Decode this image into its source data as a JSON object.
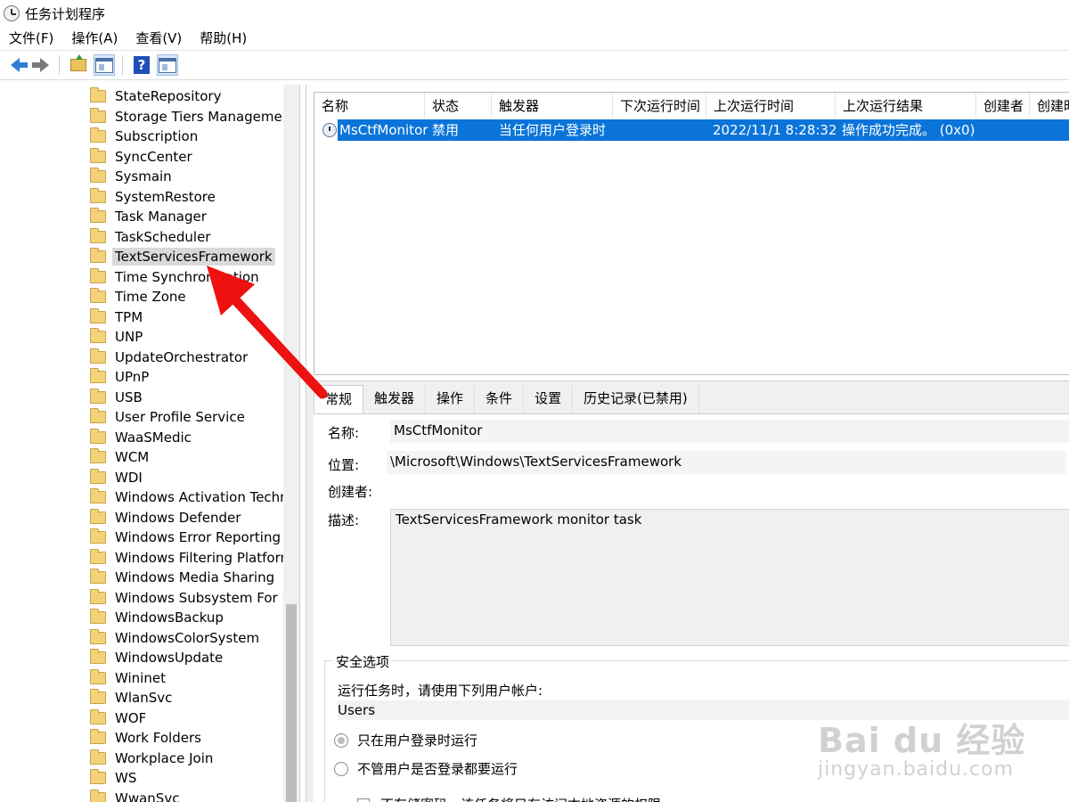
{
  "window": {
    "title": "任务计划程序"
  },
  "menu": {
    "items": [
      "文件(F)",
      "操作(A)",
      "查看(V)",
      "帮助(H)"
    ]
  },
  "toolbar": {
    "help_glyph": "?"
  },
  "tree": {
    "items": [
      {
        "label": "StateRepository",
        "selected": false
      },
      {
        "label": "Storage Tiers Management",
        "selected": false
      },
      {
        "label": "Subscription",
        "selected": false
      },
      {
        "label": "SyncCenter",
        "selected": false
      },
      {
        "label": "Sysmain",
        "selected": false
      },
      {
        "label": "SystemRestore",
        "selected": false
      },
      {
        "label": "Task Manager",
        "selected": false
      },
      {
        "label": "TaskScheduler",
        "selected": false
      },
      {
        "label": "TextServicesFramework",
        "selected": true
      },
      {
        "label": "Time Synchronization",
        "selected": false
      },
      {
        "label": "Time Zone",
        "selected": false
      },
      {
        "label": "TPM",
        "selected": false
      },
      {
        "label": "UNP",
        "selected": false
      },
      {
        "label": "UpdateOrchestrator",
        "selected": false
      },
      {
        "label": "UPnP",
        "selected": false
      },
      {
        "label": "USB",
        "selected": false
      },
      {
        "label": "User Profile Service",
        "selected": false
      },
      {
        "label": "WaaSMedic",
        "selected": false
      },
      {
        "label": "WCM",
        "selected": false
      },
      {
        "label": "WDI",
        "selected": false
      },
      {
        "label": "Windows Activation Technologies",
        "selected": false
      },
      {
        "label": "Windows Defender",
        "selected": false
      },
      {
        "label": "Windows Error Reporting",
        "selected": false
      },
      {
        "label": "Windows Filtering Platform",
        "selected": false
      },
      {
        "label": "Windows Media Sharing",
        "selected": false
      },
      {
        "label": "Windows Subsystem For Linux",
        "selected": false
      },
      {
        "label": "WindowsBackup",
        "selected": false
      },
      {
        "label": "WindowsColorSystem",
        "selected": false
      },
      {
        "label": "WindowsUpdate",
        "selected": false
      },
      {
        "label": "Wininet",
        "selected": false
      },
      {
        "label": "WlanSvc",
        "selected": false
      },
      {
        "label": "WOF",
        "selected": false
      },
      {
        "label": "Work Folders",
        "selected": false
      },
      {
        "label": "Workplace Join",
        "selected": false
      },
      {
        "label": "WS",
        "selected": false
      },
      {
        "label": "WwanSvc",
        "selected": false
      }
    ]
  },
  "task_table": {
    "columns": [
      "名称",
      "状态",
      "触发器",
      "下次运行时间",
      "上次运行时间",
      "上次运行结果",
      "创建者",
      "创建时"
    ],
    "rows": [
      {
        "name": "MsCtfMonitor",
        "status": "禁用",
        "trigger": "当任何用户登录时",
        "next_run": "",
        "last_run": "2022/11/1 8:28:32",
        "last_result": "操作成功完成。 (0x0)",
        "author": ""
      }
    ]
  },
  "detail": {
    "tabs": [
      "常规",
      "触发器",
      "操作",
      "条件",
      "设置",
      "历史记录(已禁用)"
    ],
    "active_tab": "常规",
    "name_label": "名称:",
    "name_value": "MsCtfMonitor",
    "location_label": "位置:",
    "location_value": "\\Microsoft\\Windows\\TextServicesFramework",
    "author_label": "创建者:",
    "author_value": "",
    "description_label": "描述:",
    "description_value": "TextServicesFramework monitor task",
    "security": {
      "legend": "安全选项",
      "run_as_text": "运行任务时，请使用下列用户帐户:",
      "user": "Users",
      "option_logged_on": "只在用户登录时运行",
      "option_logged_on_checked": true,
      "option_whether": "不管用户是否登录都要运行",
      "option_whether_checked": false,
      "no_password": "不存储密码。该任务将只有访问本地资源的权限"
    }
  },
  "watermark": {
    "main": "Bai du 经验",
    "sub": "jingyan.baidu.com"
  },
  "colors": {
    "selection": "#0a74d9",
    "arrow": "#ee1111",
    "tree_selected": "#d9d9d9"
  }
}
